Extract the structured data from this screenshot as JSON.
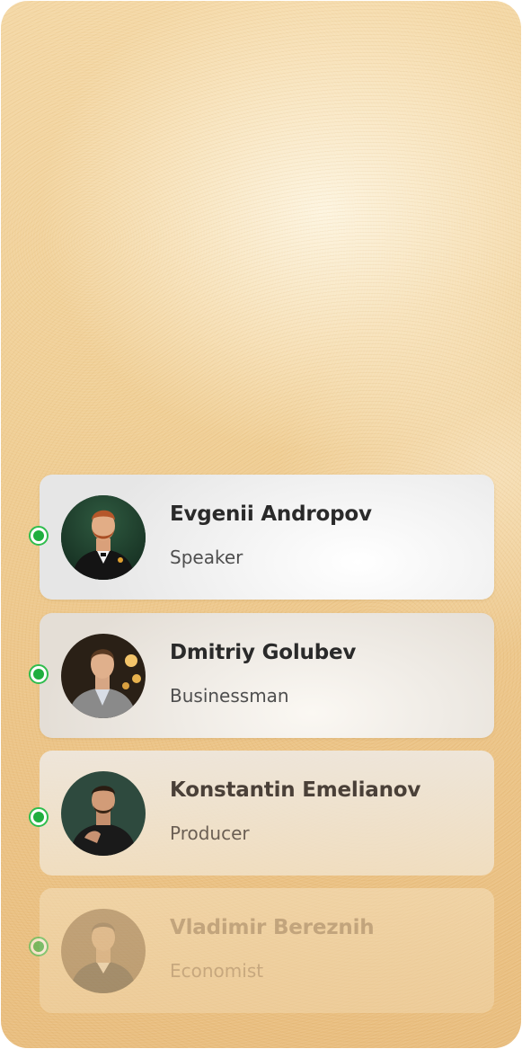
{
  "speakers": [
    {
      "name": "Evgenii Andropov",
      "role": "Speaker",
      "status": "online"
    },
    {
      "name": "Dmitriy Golubev",
      "role": "Businessman",
      "status": "online"
    },
    {
      "name": "Konstantin Emelianov",
      "role": "Producer",
      "status": "online"
    },
    {
      "name": "Vladimir Bereznih",
      "role": "Economist",
      "status": "online"
    }
  ],
  "colors": {
    "status_online": "#1fae3f",
    "background_gold": "#f0cf96",
    "text_primary": "#2a2a2a"
  }
}
